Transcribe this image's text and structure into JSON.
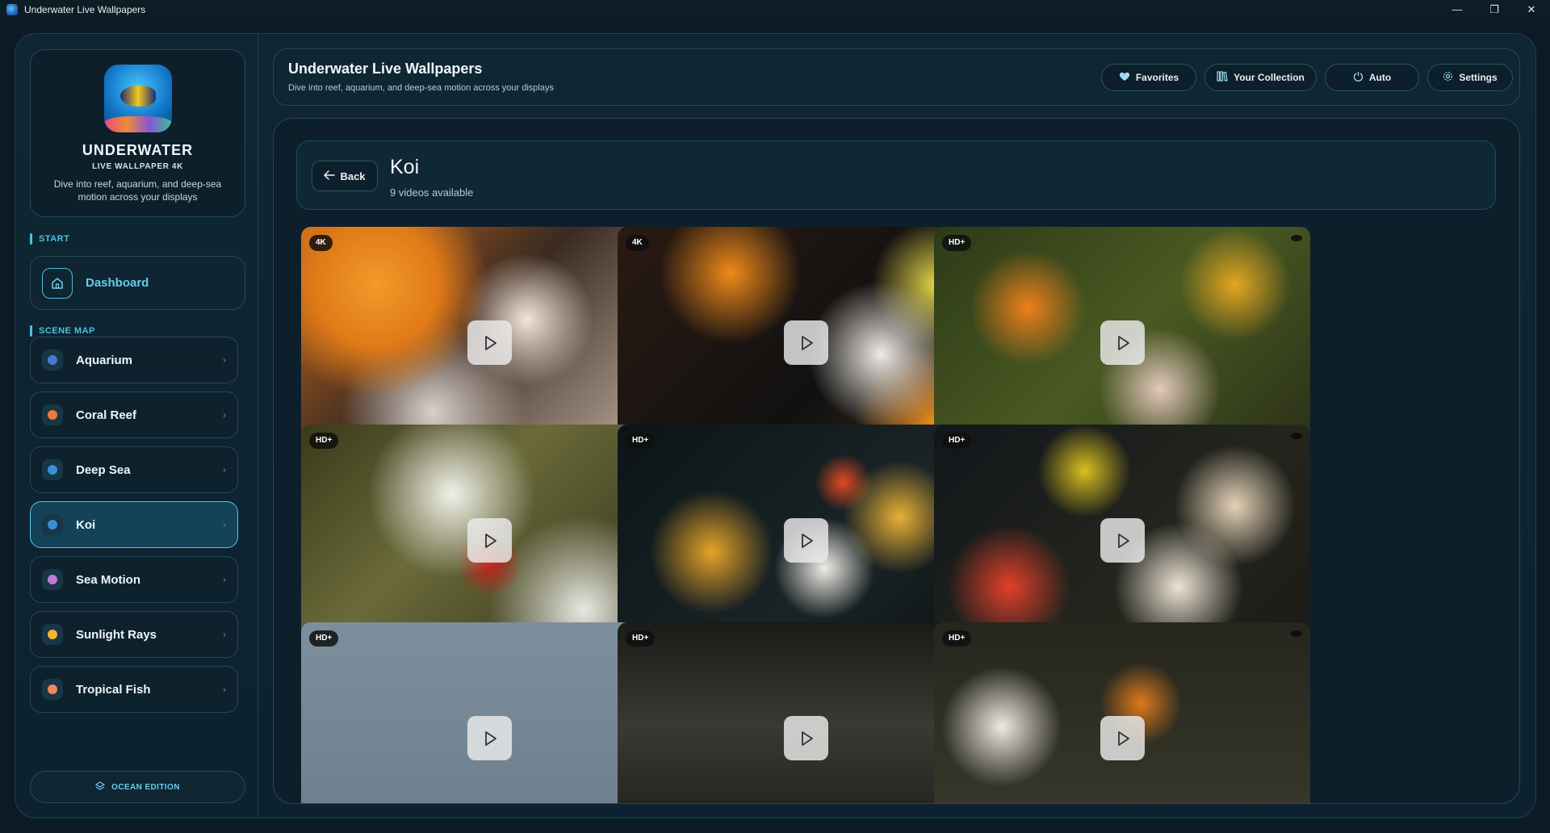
{
  "window": {
    "title": "Underwater Live Wallpapers",
    "controls": [
      "minimize",
      "restore",
      "close"
    ]
  },
  "brand": {
    "title": "UNDERWATER",
    "subtitle": "LIVE WALLPAPER 4K",
    "description": "Dive into reef, aquarium, and deep-sea motion across your displays"
  },
  "sidebar": {
    "start_label": "START",
    "dashboard_label": "Dashboard",
    "scene_map_label": "SCENE MAP",
    "items": [
      {
        "label": "Aquarium",
        "icon": "aquarium-icon",
        "color": "#4a7bd1"
      },
      {
        "label": "Coral Reef",
        "icon": "coral-icon",
        "color": "#f07a3a"
      },
      {
        "label": "Deep Sea",
        "icon": "deep-sea-icon",
        "color": "#3a8fd6"
      },
      {
        "label": "Koi",
        "icon": "koi-icon",
        "color": "#3a8fd6",
        "active": true
      },
      {
        "label": "Sea Motion",
        "icon": "sea-motion-icon",
        "color": "#c07ad8"
      },
      {
        "label": "Sunlight Rays",
        "icon": "sun-icon",
        "color": "#f2b631"
      },
      {
        "label": "Tropical Fish",
        "icon": "tropical-fish-icon",
        "color": "#f08a5a"
      }
    ],
    "edition_label": "OCEAN EDITION"
  },
  "header": {
    "title": "Underwater Live Wallpapers",
    "subtitle": "Dive into reef, aquarium, and deep-sea motion across your displays",
    "buttons": {
      "favorites": "Favorites",
      "collection": "Your Collection",
      "auto": "Auto",
      "settings": "Settings"
    }
  },
  "category": {
    "back_label": "Back",
    "title": "Koi",
    "count": "9 videos available"
  },
  "videos": [
    {
      "badge": "4K"
    },
    {
      "badge": "4K"
    },
    {
      "badge": "HD+"
    },
    {
      "badge": "HD+"
    },
    {
      "badge": "HD+"
    },
    {
      "badge": "HD+"
    },
    {
      "badge": "HD+"
    },
    {
      "badge": "HD+"
    },
    {
      "badge": "HD+"
    }
  ],
  "colors": {
    "accent": "#4fc0de",
    "background": "#0b1a24",
    "active_nav": "#134259"
  }
}
